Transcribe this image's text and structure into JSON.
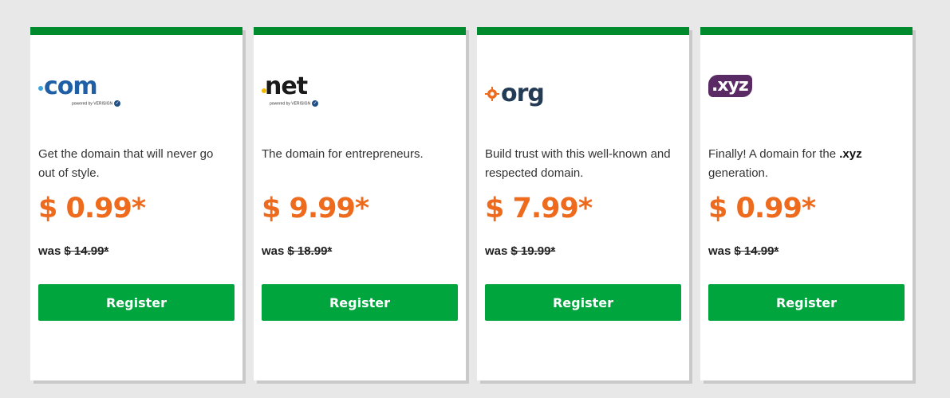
{
  "colors": {
    "card_top_bar": "#008a2e",
    "price": "#ee6a1c",
    "register_button": "#00a63d",
    "page_background": "#e8e8e8"
  },
  "cards": [
    {
      "logo": {
        "text": "com",
        "powered": "powered by VERISIGN",
        "icon": "com-logo"
      },
      "description_pre": "Get the domain that will never go out of style.",
      "description_bold": "",
      "description_post": "",
      "price": "$ 0.99*",
      "was_label": "was",
      "was_price": "$ 14.99*",
      "register_label": "Register"
    },
    {
      "logo": {
        "text": "net",
        "powered": "powered by VERISIGN",
        "icon": "net-logo"
      },
      "description_pre": "The domain for entrepreneurs.",
      "description_bold": "",
      "description_post": "",
      "price": "$ 9.99*",
      "was_label": "was",
      "was_price": "$ 18.99*",
      "register_label": "Register"
    },
    {
      "logo": {
        "text": "org",
        "icon": "org-logo"
      },
      "description_pre": "Build trust with this well-known and respected domain.",
      "description_bold": "",
      "description_post": "",
      "price": "$ 7.99*",
      "was_label": "was",
      "was_price": "$ 19.99*",
      "register_label": "Register"
    },
    {
      "logo": {
        "text": ".xyz",
        "icon": "xyz-logo"
      },
      "description_pre": "Finally! A domain for the ",
      "description_bold": ".xyz",
      "description_post": " generation.",
      "price": "$ 0.99*",
      "was_label": "was",
      "was_price": "$ 14.99*",
      "register_label": "Register"
    }
  ]
}
